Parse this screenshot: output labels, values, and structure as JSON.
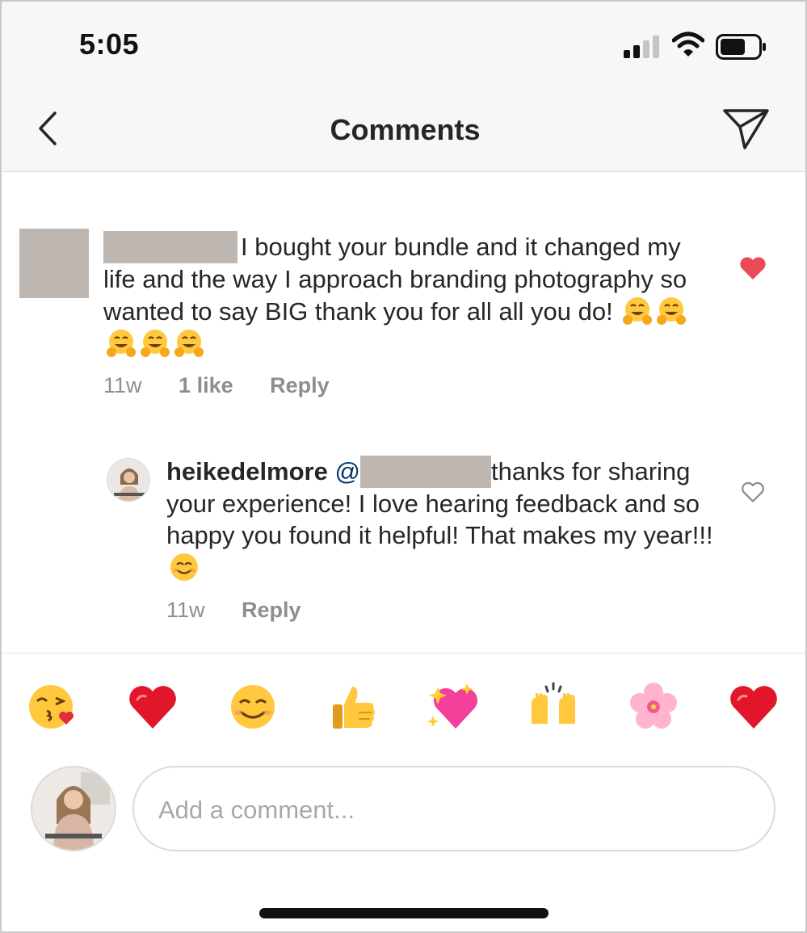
{
  "status_bar": {
    "time": "5:05"
  },
  "header": {
    "title": "Comments",
    "back_icon": "chevron-left-icon",
    "share_icon": "paper-plane-icon"
  },
  "comments": [
    {
      "text": "I bought your bundle and it changed my life and the way I approach branding photography so wanted to say BIG thank you for all all you do!",
      "emojis": [
        "hugging-face",
        "hugging-face",
        "hugging-face",
        "hugging-face",
        "hugging-face"
      ],
      "time": "11w",
      "likes": "1 like",
      "reply_label": "Reply",
      "liked": true,
      "reply": {
        "username": "heikedelmore",
        "mention_prefix": "@",
        "text": "thanks for sharing your experience! I love hearing feedback and so happy you found it helpful! That makes my year!!!",
        "emoji": "smiling-face",
        "time": "11w",
        "reply_label": "Reply",
        "liked": false
      }
    }
  ],
  "emoji_bar": [
    "face-blowing-kiss",
    "red-heart",
    "smiling-face",
    "thumbs-up",
    "sparkling-heart",
    "raising-hands",
    "cherry-blossom",
    "red-heart"
  ],
  "composer": {
    "placeholder": "Add a comment..."
  },
  "colors": {
    "like_red": "#ed4956",
    "text": "#262626",
    "muted": "#8e8e8e",
    "mention": "#00376b"
  }
}
